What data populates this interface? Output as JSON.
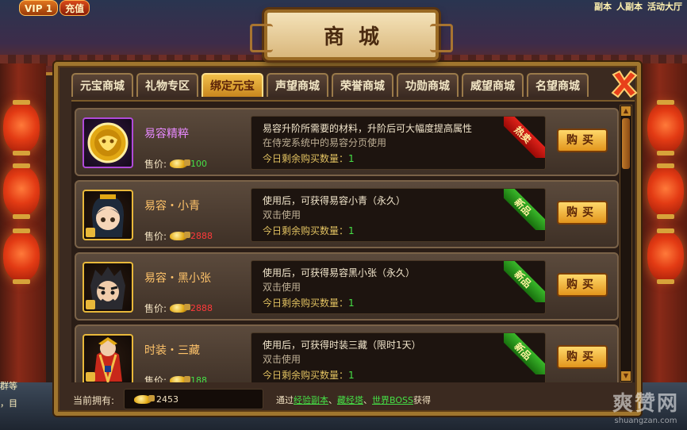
{
  "hud": {
    "vip": "VIP 1",
    "recharge": "充值",
    "top_right": [
      "副本",
      "人副本",
      "活动大厅"
    ],
    "side_text": [
      "群等",
      "，目"
    ]
  },
  "title": "商城",
  "tabs": [
    {
      "label": "元宝商城",
      "active": false
    },
    {
      "label": "礼物专区",
      "active": false
    },
    {
      "label": "绑定元宝",
      "active": true
    },
    {
      "label": "声望商城",
      "active": false
    },
    {
      "label": "荣誉商城",
      "active": false
    },
    {
      "label": "功勋商城",
      "active": false
    },
    {
      "label": "威望商城",
      "active": false
    },
    {
      "label": "名望商城",
      "active": false
    }
  ],
  "price_label": "售价:",
  "buy_label": "购买",
  "items": [
    {
      "name": "易容精粹",
      "price": "100",
      "price_color": "green",
      "frame": "purple",
      "desc1": "易容升阶所需要的材料，升阶后可大幅度提高属性",
      "desc2": "在侍宠系统中的易容分页使用",
      "remain_label": "今日剩余购买数量：",
      "remain": "1",
      "ribbon": "热卖",
      "ribbon_color": "red",
      "icon": "gold-mask-token-icon"
    },
    {
      "name": "易容・小青",
      "price": "2888",
      "price_color": "red",
      "frame": "gold",
      "desc1": "使用后，可获得易容小青（永久）",
      "desc2": "双击使用",
      "remain_label": "今日剩余购买数量：",
      "remain": "1",
      "ribbon": "新品",
      "ribbon_color": "green",
      "icon": "xiaoqing-portrait-icon"
    },
    {
      "name": "易容・黑小张",
      "price": "2888",
      "price_color": "red",
      "frame": "gold",
      "desc1": "使用后，可获得易容黑小张（永久）",
      "desc2": "双击使用",
      "remain_label": "今日剩余购买数量：",
      "remain": "1",
      "ribbon": "新品",
      "ribbon_color": "green",
      "icon": "heixiaozhang-portrait-icon"
    },
    {
      "name": "时装・三藏",
      "price": "188",
      "price_color": "green",
      "frame": "gold",
      "desc1": "使用后，可获得时装三藏（限时1天）",
      "desc2": "双击使用",
      "remain_label": "今日剩余购买数量：",
      "remain": "1",
      "ribbon": "新品",
      "ribbon_color": "green",
      "icon": "sanzang-costume-icon"
    }
  ],
  "footer": {
    "owned_label": "当前拥有:",
    "owned_value": "2453",
    "source_prefix": "通过",
    "links": [
      "经验副本",
      "藏经塔",
      "世界BOSS"
    ],
    "sep": "、",
    "source_suffix": "获得"
  },
  "watermark": {
    "main": "爽赞网",
    "sub": "shuangzan.com"
  }
}
